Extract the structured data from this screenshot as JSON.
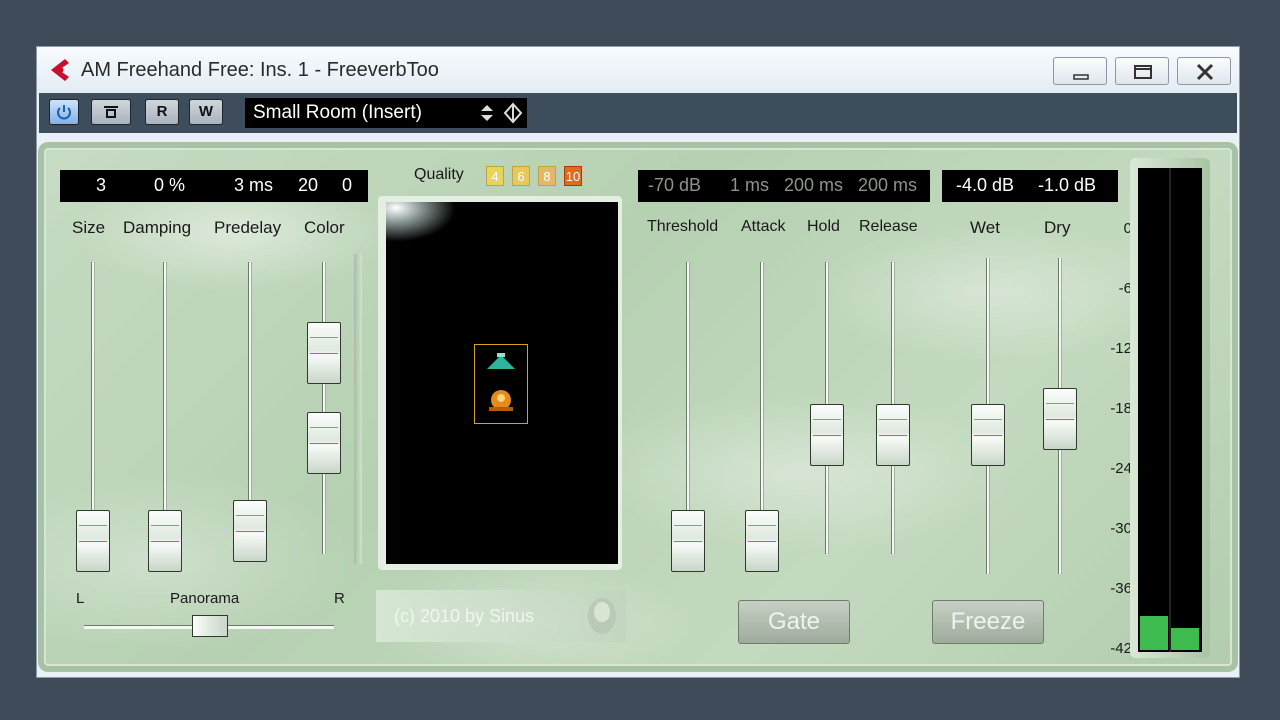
{
  "window": {
    "title": "AM Freehand Free: Ins. 1 - FreeverbToo",
    "minimize_icon": "minimize-icon",
    "maximize_icon": "maximize-icon",
    "close_icon": "close-icon"
  },
  "toolbar": {
    "power_icon": "power-icon",
    "bypass_icon": "bypass-icon",
    "read_label": "R",
    "write_label": "W",
    "preset_name": "Small Room  (Insert)"
  },
  "plugin": {
    "left_display": [
      "3",
      "0 %",
      "3 ms",
      "20",
      "0"
    ],
    "left_labels": [
      "Size",
      "Damping",
      "Predelay",
      "Color"
    ],
    "panorama": {
      "label": "Panorama",
      "left": "L",
      "right": "R"
    },
    "quality": {
      "label": "Quality",
      "options": [
        "4",
        "6",
        "8",
        "10"
      ],
      "selected": "10"
    },
    "copyright": "(c) 2010 by Sinus",
    "gate_display": [
      "-70 dB",
      "1 ms",
      "200 ms",
      "200 ms"
    ],
    "gate_labels": [
      "Threshold",
      "Attack",
      "Hold",
      "Release"
    ],
    "mix_display": [
      "-4.0 dB",
      "-1.0 dB"
    ],
    "mix_labels": [
      "Wet",
      "Dry"
    ],
    "gate_button": "Gate",
    "freeze_button": "Freeze",
    "meter_scale": [
      "0",
      "-6",
      "-12",
      "-18",
      "-24",
      "-30",
      "-36",
      "-42"
    ],
    "colors": {
      "lcd": "#000000",
      "panel": "#bcd5b8",
      "meter": "#3dbb4f",
      "quality_active": "#e06a1e"
    }
  }
}
